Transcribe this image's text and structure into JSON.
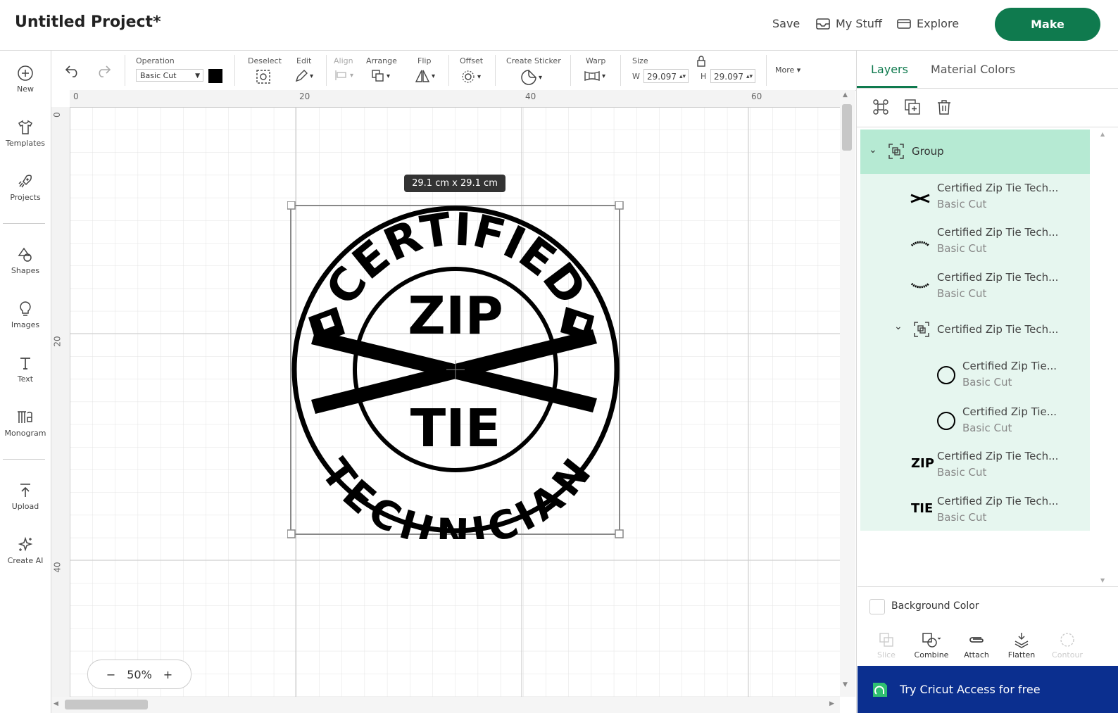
{
  "header": {
    "project_title": "Untitled Project*",
    "save_label": "Save",
    "mystuff_label": "My Stuff",
    "explore_label": "Explore",
    "make_label": "Make",
    "accent_color": "#0f7a4e"
  },
  "sidebar": {
    "items": [
      {
        "label": "New",
        "icon": "plus-circle-icon"
      },
      {
        "label": "Templates",
        "icon": "tshirt-icon"
      },
      {
        "label": "Projects",
        "icon": "rocket-icon"
      },
      {
        "label": "Shapes",
        "icon": "shapes-icon"
      },
      {
        "label": "Images",
        "icon": "lightbulb-icon"
      },
      {
        "label": "Text",
        "icon": "text-icon"
      },
      {
        "label": "Monogram",
        "icon": "monogram-icon"
      },
      {
        "label": "Upload",
        "icon": "upload-icon"
      },
      {
        "label": "Create AI",
        "icon": "sparkle-icon"
      }
    ]
  },
  "toolbar": {
    "operation_label": "Operation",
    "operation_value": "Basic Cut",
    "deselect_label": "Deselect",
    "edit_label": "Edit",
    "align_label": "Align",
    "arrange_label": "Arrange",
    "flip_label": "Flip",
    "offset_label": "Offset",
    "create_sticker_label": "Create Sticker",
    "warp_label": "Warp",
    "size_label": "Size",
    "w_label": "W",
    "w_value": "29.097",
    "h_label": "H",
    "h_value": "29.097",
    "more_label": "More"
  },
  "canvas": {
    "ruler_h": [
      "0",
      "20",
      "40",
      "60"
    ],
    "ruler_v": [
      "0",
      "20",
      "40"
    ],
    "size_tooltip": "29.1 cm x 29.1 cm",
    "design_text": {
      "top_arc": "CERTIFIED",
      "bottom_arc": "TECHNICIAN",
      "upper_center": "ZIP",
      "lower_center": "TIE"
    },
    "zoom_value": "50%",
    "zoom_minus": "−",
    "zoom_plus": "+"
  },
  "panel": {
    "tab_layers": "Layers",
    "tab_material": "Material Colors",
    "group_label": "Group",
    "layers": [
      {
        "name": "Certified Zip Tie Tech...",
        "sub": "Basic Cut",
        "thumb": "crossed-ties"
      },
      {
        "name": "Certified Zip Tie Tech...",
        "sub": "Basic Cut",
        "thumb": "top-arc"
      },
      {
        "name": "Certified Zip Tie Tech...",
        "sub": "Basic Cut",
        "thumb": "bottom-arc"
      },
      {
        "name": "Certified Zip Tie Tech...",
        "sub": "",
        "thumb": "group"
      },
      {
        "name": "Certified Zip Tie...",
        "sub": "Basic Cut",
        "thumb": "circle"
      },
      {
        "name": "Certified Zip Tie...",
        "sub": "Basic Cut",
        "thumb": "circle"
      },
      {
        "name": "Certified Zip Tie Tech...",
        "sub": "Basic Cut",
        "thumb": "ZIP"
      },
      {
        "name": "Certified Zip Tie Tech...",
        "sub": "Basic Cut",
        "thumb": "TIE"
      }
    ],
    "background_color_label": "Background Color",
    "bottom_tools": [
      "Slice",
      "Combine",
      "Attach",
      "Flatten",
      "Contour"
    ],
    "cta_label": "Try Cricut Access for free",
    "cta_color": "#0b2f8f"
  }
}
